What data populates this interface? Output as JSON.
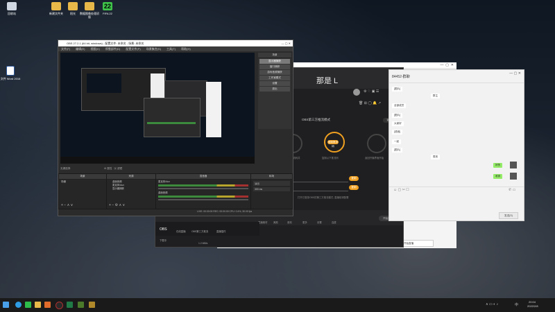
{
  "desktop": {
    "icons": [
      {
        "label": "回收站"
      },
      {
        "label": "新建文件夹"
      },
      {
        "label": "阳光"
      },
      {
        "label": "数据图像处理初版"
      },
      {
        "label": "FIFA 22"
      },
      {
        "label": "文件 Word 2016"
      }
    ]
  },
  "obs": {
    "title": "OBS 27.2.1 (64 bit, windows) - 配置文件: 未命名 - 场景: 未命名",
    "menu": [
      "文件(F)",
      "编辑(E)",
      "视图(V)",
      "停靠部件(D)",
      "配置文件(P)",
      "场景集合(S)",
      "工具(T)",
      "帮助(H)"
    ],
    "scene_panel_title": "场景",
    "scene_items": [
      "显示器捕获",
      "窗口捕获",
      "游戏音频捕获",
      "工作室模式",
      "设置",
      "退出"
    ],
    "preview_label": "无源选择",
    "docks": {
      "scenes": "场景",
      "sources": "来源",
      "mixer": "混音器",
      "transitions": "转场"
    },
    "scene_list_item": "场景",
    "sources": [
      "桌面音频",
      "麦克风/Aux",
      "显示器捕获"
    ],
    "mixer": [
      {
        "name": "麦克风/Aux",
        "db": "0.0 dB"
      },
      {
        "name": "桌面音频",
        "db": "0.0 dB"
      }
    ],
    "transition_name": "淡出",
    "transition_duration": "300 ms",
    "status": "LIVE: 00:00:00   REC: 00:00:00   CPU: 0.4%, 30.00 fps"
  },
  "app2": {
    "title": "那是 L",
    "feature_title": "OBS第三方推流模式",
    "step_labels": [
      "推流码",
      "复制推流码",
      "返回开播"
    ],
    "step_captions": [
      "在以下导入推流码并",
      "复制以下推流码",
      "返回开播界面开始"
    ],
    "orange_btn_label": "复制",
    "small_btn_label": "返回",
    "tabs": [
      "OBS",
      "在线直播",
      "OBS第三方推流",
      "直播插件"
    ],
    "footer_left": "下载中",
    "footer_size": "1.2 MB/s",
    "toolbar_items": [
      "直播素材",
      "美颜",
      "音效",
      "更多",
      "设置",
      "连麦"
    ],
    "start_label": "开始直播",
    "caption": "打开已登录OBS的第三方推流模式, 直播前请配置"
  },
  "chat": {
    "title": "84452-群聊",
    "messages_left": [
      "[图片]",
      "群主",
      "全部成员",
      "[图片]",
      "大家好",
      "[语音]",
      "一起",
      "[图片]",
      "周末",
      "[链接]",
      "欢迎"
    ],
    "messages_right": [
      "好的",
      "收到"
    ],
    "send_label": "发送(S)"
  },
  "wwin": {
    "bottom_label": "开始直播"
  },
  "taskbar": {
    "time": "20:04",
    "date": "2022/2/8",
    "lang": "中"
  },
  "colors": {
    "accent": "#f0a020",
    "green_bubble": "#95ec69",
    "obs_bg": "#2b2b2b"
  }
}
